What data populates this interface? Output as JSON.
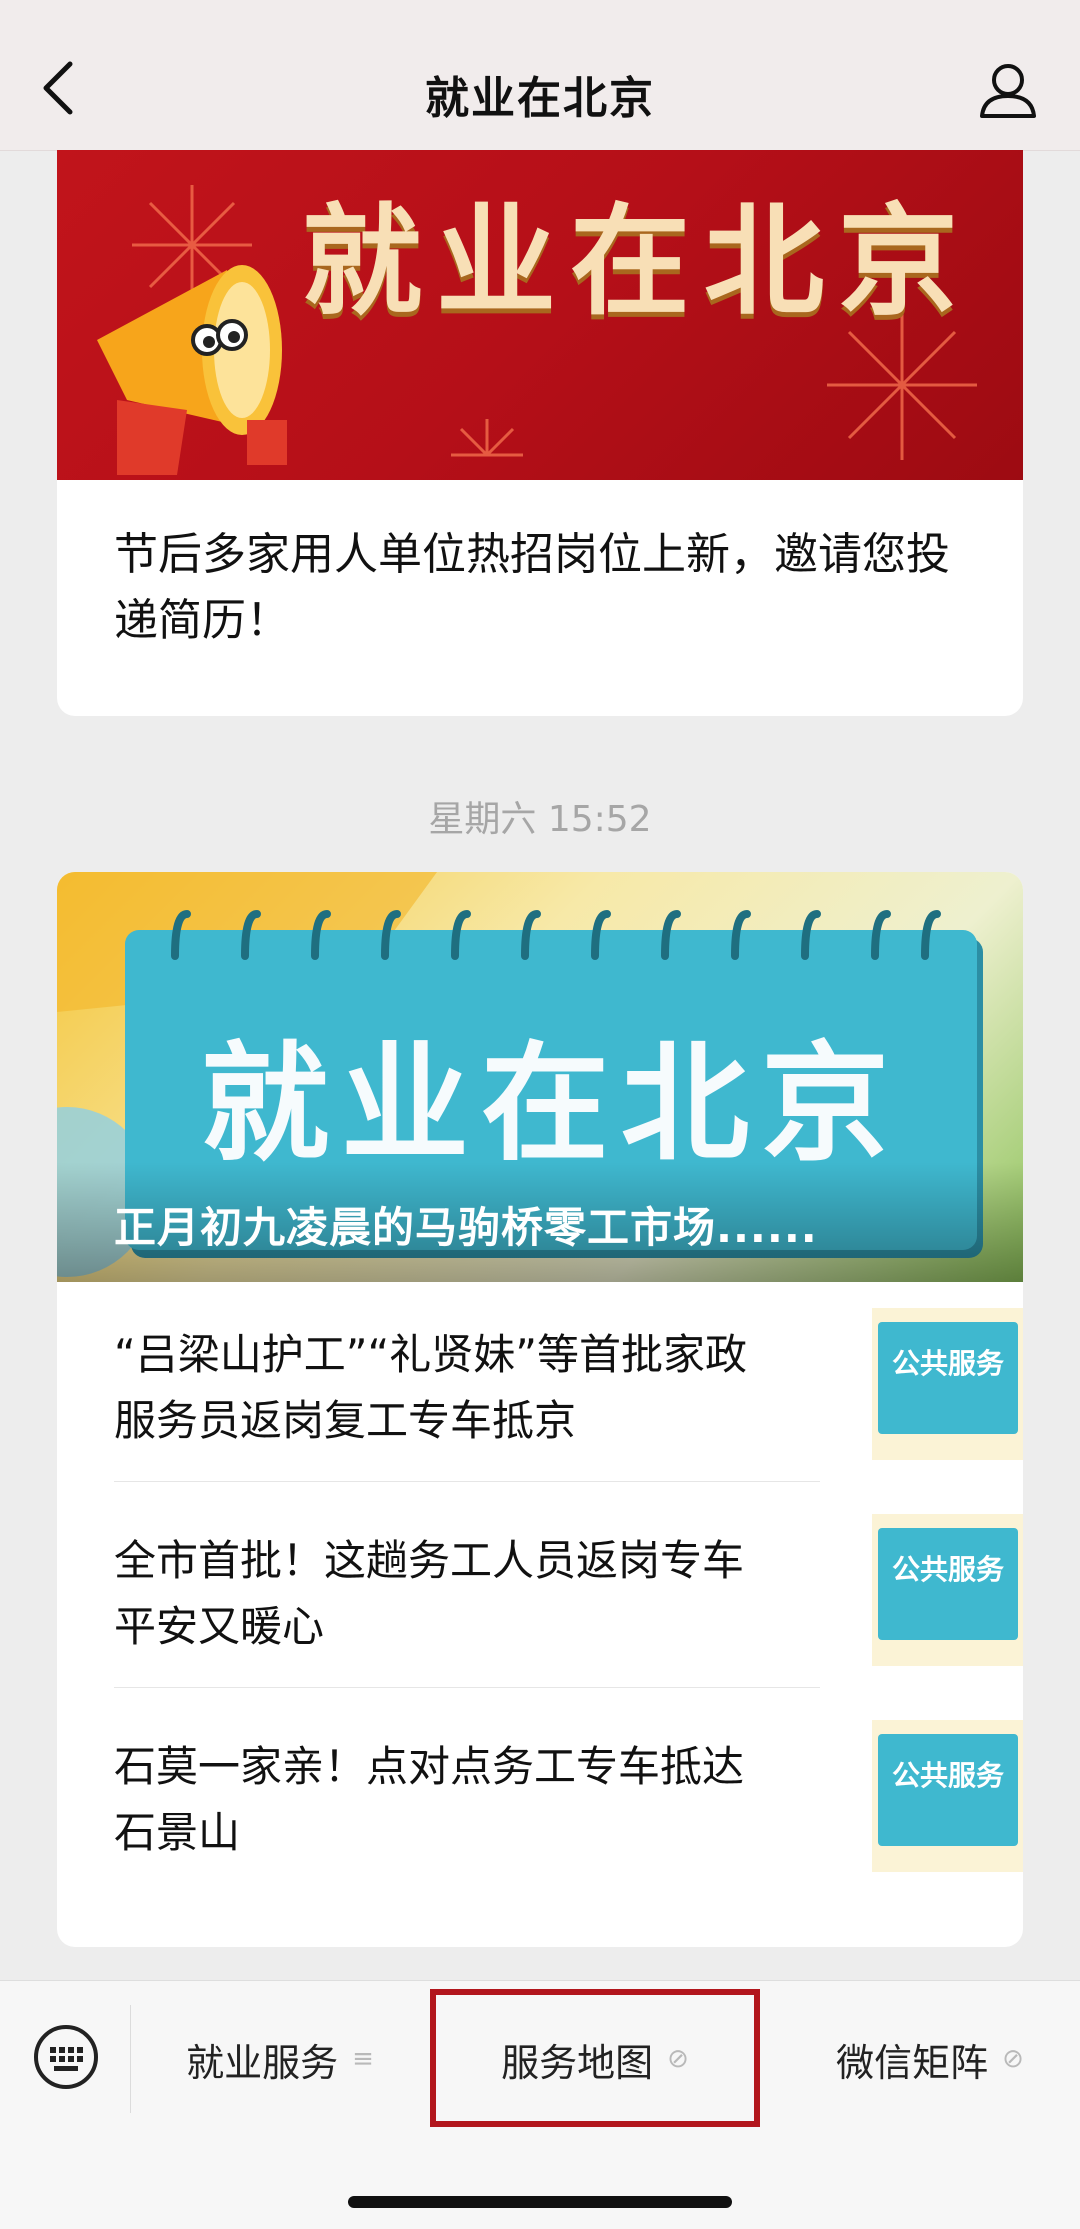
{
  "header": {
    "title": "就业在北京",
    "back_icon": "chevron-left-icon",
    "profile_icon": "user-icon"
  },
  "card1": {
    "banner_title": "就业在北京",
    "text": "节后多家用人单位热招岗位上新，邀请您投递简历！"
  },
  "timestamp": "星期六 15:52",
  "card2": {
    "banner_title": "就业在北京",
    "banner_caption": "正月初九凌晨的马驹桥零工市场......",
    "items": [
      {
        "text": "“吕梁山护工”“礼贤妹”等首批家政服务员返岗复工专车抵京",
        "thumb": "公共服务"
      },
      {
        "text": "全市首批！这趟务工人员返岗专车平安又暖心",
        "thumb": "公共服务"
      },
      {
        "text": "石莫一家亲！点对点务工专车抵达石景山",
        "thumb": "公共服务"
      }
    ]
  },
  "menu": {
    "keyboard_icon": "keyboard-icon",
    "items": [
      {
        "label": "就业服务",
        "icon": "≡"
      },
      {
        "label": "服务地图",
        "icon": "⊘"
      },
      {
        "label": "微信矩阵",
        "icon": "⊘"
      }
    ]
  },
  "colors": {
    "highlight_border": "#b2161d",
    "banner_red": "#c1141b",
    "calendar_blue": "#3fb8cf"
  }
}
